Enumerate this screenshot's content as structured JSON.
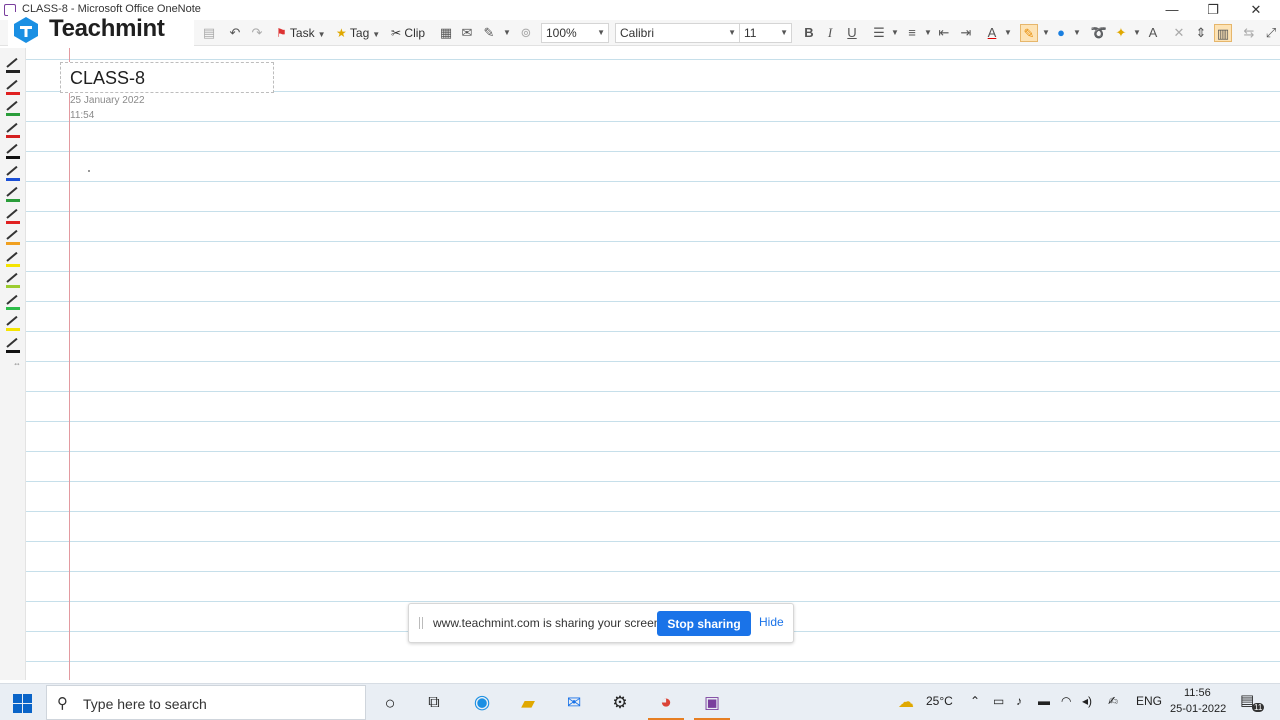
{
  "window": {
    "title": "CLASS-8 - Microsoft Office OneNote",
    "controls": [
      "—",
      "❐",
      "✕"
    ]
  },
  "brand": {
    "name": "Teachmint",
    "color": "#1a8fe3"
  },
  "toolbar": {
    "task_label": "Task",
    "tag_label": "Tag",
    "clip_label": "Clip",
    "zoom_value": "100%",
    "font_value": "Calibri",
    "font_size_value": "11",
    "bold": "B",
    "italic": "I",
    "underline": "U",
    "font_color_glyph": "A",
    "clear_format_glyph": "A"
  },
  "page": {
    "title": "CLASS-8",
    "date": "25 January 2022",
    "time": "11:54"
  },
  "pen_colors": [
    "#222222",
    "#e02020",
    "#2a9d3a",
    "#d42020",
    "#111111",
    "#1a4fd6",
    "#2a9d3a",
    "#e02020",
    "#f0a020",
    "#f5e400",
    "#9ccc30",
    "#2ebd4a",
    "#f5e400",
    "#111111"
  ],
  "share_bar": {
    "message": "www.teachmint.com is sharing your screen.",
    "stop_label": "Stop sharing",
    "hide_label": "Hide",
    "accent": "#1a73e8"
  },
  "taskbar": {
    "search_placeholder": "Type here to search",
    "weather": "25°C",
    "language": "ENG",
    "time": "11:56",
    "date": "25-01-2022",
    "notification_count": "11"
  }
}
